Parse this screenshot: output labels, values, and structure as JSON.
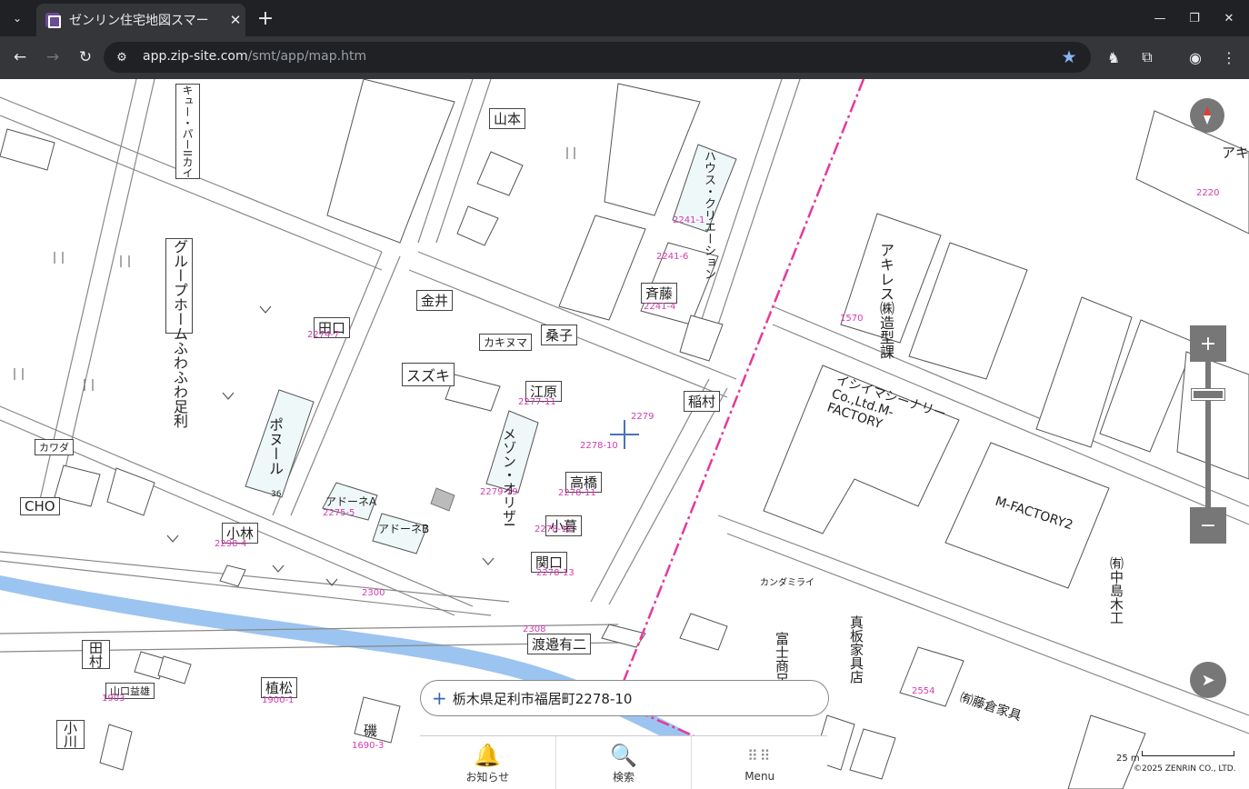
{
  "browser": {
    "tab_title": "ゼンリン住宅地図スマー",
    "url_host": "app.zip-site.com",
    "url_path": "/smt/app/map.htm",
    "accent_color": "#8ab4f8"
  },
  "map": {
    "labels": {
      "yamamoto": "山本",
      "kyupa": "キュー・パーIIカイ",
      "group_home": "グループホームふわふわ足利",
      "kanai": "金井",
      "taguchi": "田口",
      "kuwako": "桑子",
      "kakinuma": "カキヌマ",
      "suzuki": "スズキ",
      "ebara": "江原",
      "saito": "斉藤",
      "inamura": "稲村",
      "pol": "ポヌール",
      "maison": "メゾン・オリザI",
      "kawada": "カワダ",
      "cho": "CHO",
      "kobayashi": "小林",
      "adone_a": "アドーネA",
      "adone_b": "アドーネB",
      "takahashi": "高橋",
      "kogure": "小暮",
      "sekiguchi": "関口",
      "watanabe": "渡邉有二",
      "uematsu": "植松",
      "iso": "磯",
      "ogawa": "小川",
      "yamaguchi": "山口益雄",
      "tamura": "田村",
      "akiresu": "アキレス㈱造型課",
      "ishii": "イシイマシーナリーCo.,Ltd.M-FACTORY",
      "mfactory2": "M-FACTORY2",
      "nakajima": "㈲中島木工",
      "makita": "真板家具店",
      "fujisho": "富士商足利セン",
      "kanda": "カンダミライ",
      "fujikura": "㈲藤倉家具",
      "aki": "アキ",
      "hausu": "ハウス・クリエーション",
      "num_2241_6": "2241-6",
      "num_2241_1": "2241-1",
      "num_2241_4": "2241-4",
      "num_2279": "2279",
      "num_2278_10": "2278-10",
      "num_2278_11": "2278-11",
      "num_2278_12": "2278-12",
      "num_2278_13": "2278-13",
      "num_2279_19": "2279-19",
      "num_2277_11": "2277-11",
      "num_2274_7": "2274-7",
      "num_2275_5": "2275-5",
      "num_2298_4": "2298-4",
      "num_2300": "2300",
      "num_2308": "2308",
      "num_1900_1": "1900-1",
      "num_1690_3": "1690-3",
      "num_1903": "1903",
      "num_2220": "2220",
      "num_1570": "1570",
      "num_2554": "2554",
      "num_36": "36"
    },
    "address": "栃木県足利市福居町2278-10",
    "scale_label": "25 m",
    "copyright": "©2025 ZENRIN CO., LTD.",
    "line_color": "#e6399b",
    "river_color": "#9cc4f0"
  },
  "controls": {
    "zoom_in": "+",
    "zoom_out": "−"
  },
  "bottom_menu": [
    {
      "label": "お知らせ",
      "icon": "bell-icon"
    },
    {
      "label": "検索",
      "icon": "search-icon"
    },
    {
      "label": "Menu",
      "icon": "grid-menu-icon"
    }
  ]
}
